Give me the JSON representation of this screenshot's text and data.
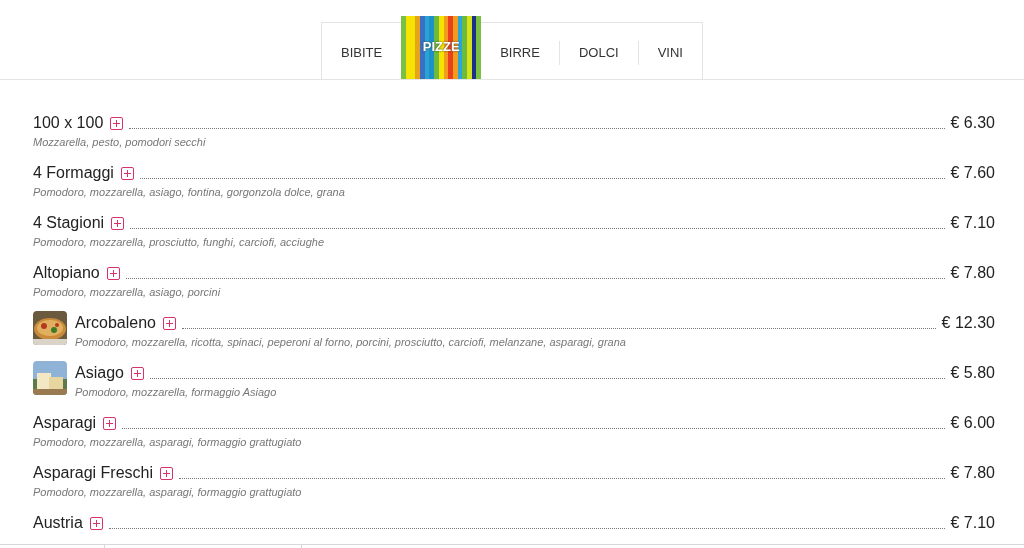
{
  "tabs": [
    {
      "label": "BIBITE",
      "selected": false
    },
    {
      "label": "PIZZE",
      "selected": true
    },
    {
      "label": "BIRRE",
      "selected": false
    },
    {
      "label": "DOLCI",
      "selected": false
    },
    {
      "label": "VINI",
      "selected": false
    }
  ],
  "items": [
    {
      "name": "100 x 100",
      "description": "Mozzarella, pesto, pomodori secchi",
      "price": "€ 6.30"
    },
    {
      "name": "4 Formaggi",
      "description": "Pomodoro, mozzarella, asiago, fontina, gorgonzola dolce, grana",
      "price": "€ 7.60"
    },
    {
      "name": "4 Stagioni",
      "description": "Pomodoro, mozzarella, prosciutto, funghi, carciofi, acciughe",
      "price": "€ 7.10"
    },
    {
      "name": "Altopiano",
      "description": "Pomodoro, mozzarella, asiago, porcini",
      "price": "€ 7.80"
    },
    {
      "name": "Arcobaleno",
      "description": "Pomodoro, mozzarella, ricotta, spinaci, peperoni al forno, porcini, prosciutto, carciofi, melanzane, asparagi, grana",
      "price": "€ 12.30",
      "kind": "picture"
    },
    {
      "name": "Asiago",
      "description": "Pomodoro, mozzarella, formaggio Asiago",
      "price": "€ 5.80",
      "kind": "picture"
    },
    {
      "name": "Asparagi",
      "description": "Pomodoro, mozzarella, asparagi, formaggio grattugiato",
      "price": "€ 6.00"
    },
    {
      "name": "Asparagi Freschi",
      "description": "Pomodoro, mozzarella, asparagi, formaggio grattugiato",
      "price": "€ 7.80"
    },
    {
      "name": "Austria",
      "price": "€ 7.10"
    }
  ]
}
